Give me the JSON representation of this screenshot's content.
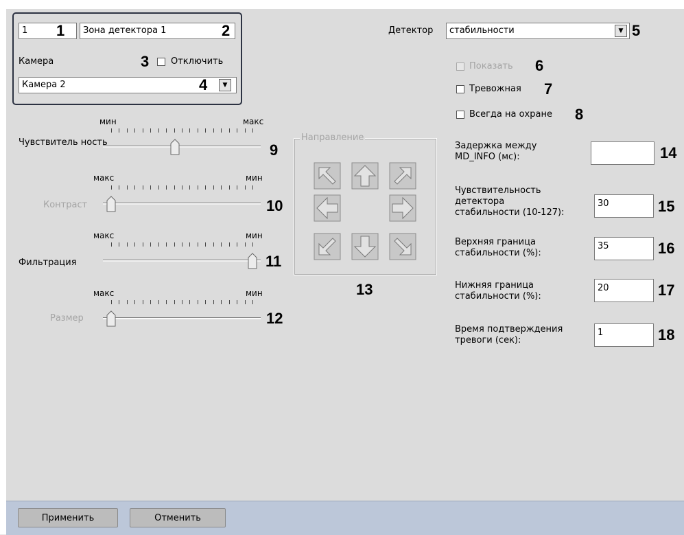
{
  "zone": {
    "number_value": "1",
    "name_value": "Зона детектора 1",
    "camera_label": "Камера",
    "disable_label": "Отключить",
    "camera_value": "Камера 2"
  },
  "detector": {
    "label": "Детектор",
    "value": "стабильности",
    "show_label": "Показать",
    "alarm_label": "Тревожная",
    "always_armed_label": "Всегда на охране"
  },
  "sliders": {
    "sensitivity": {
      "label": "Чувствитель ность",
      "left_caption": "мин",
      "right_caption": "макс",
      "value": 0.45
    },
    "contrast": {
      "label": "Контраст",
      "left_caption": "макс",
      "right_caption": "мин",
      "value": 0.0
    },
    "filtration": {
      "label": "Фильтрация",
      "left_caption": "макс",
      "right_caption": "мин",
      "value": 1.0
    },
    "size": {
      "label": "Размер",
      "left_caption": "макс",
      "right_caption": "мин",
      "value": 0.0
    }
  },
  "direction": {
    "legend": "Направление"
  },
  "params": {
    "delay": {
      "label_line1": "Задержка между",
      "label_line2": "MD_INFO (мс):",
      "value": ""
    },
    "sens": {
      "label_line1": "Чувствительность",
      "label_line2": "детектора",
      "label_line3": "стабильности (10-127):",
      "value": "30"
    },
    "upper": {
      "label_line1": "Верхняя граница",
      "label_line2": "стабильности (%):",
      "value": "35"
    },
    "lower": {
      "label_line1": "Нижняя граница",
      "label_line2": "стабильности (%):",
      "value": "20"
    },
    "confirm": {
      "label_line1": "Время подтверждения",
      "label_line2": "тревоги (сек):",
      "value": "1"
    }
  },
  "callouts": [
    "1",
    "2",
    "3",
    "4",
    "5",
    "6",
    "7",
    "8",
    "9",
    "10",
    "11",
    "12",
    "13",
    "14",
    "15",
    "16",
    "17",
    "18"
  ],
  "buttons": {
    "apply": "Применить",
    "cancel": "Отменить"
  },
  "icons": {
    "arrow_nw": "arrow-up-left-icon",
    "arrow_n": "arrow-up-icon",
    "arrow_ne": "arrow-up-right-icon",
    "arrow_w": "arrow-left-icon",
    "arrow_e": "arrow-right-icon",
    "arrow_sw": "arrow-down-left-icon",
    "arrow_s": "arrow-down-icon",
    "arrow_se": "arrow-down-right-icon"
  },
  "colors": {
    "panel_bg": "#dcdcdc",
    "bottom_bar": "#bcc7d9",
    "group_border": "#2c3242",
    "disabled_text": "#a4a4a4"
  }
}
